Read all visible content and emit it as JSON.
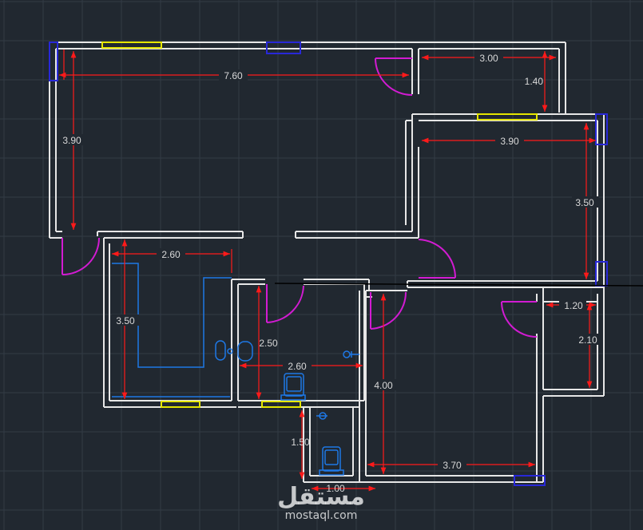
{
  "colors": {
    "background": "#212830",
    "grid": "#323b45",
    "wall": "#e6e6e6",
    "dimension": "#ff1a1a",
    "door": "#d21bd2",
    "window_yellow": "#e6e600",
    "window_blue": "#2828d8",
    "fixture": "#1e78e6",
    "cut_line": "#000000"
  },
  "dimensions": {
    "d760": "7.60",
    "d300": "3.00",
    "d140": "1.40",
    "d390a": "3.90",
    "d390b": "3.90",
    "d350a": "3.50",
    "d260a": "2.60",
    "d350b": "3.50",
    "d250": "2.50",
    "d260b": "2.60",
    "d400": "4.00",
    "d120": "1.20",
    "d210": "2.10",
    "d150": "1.50",
    "d370": "3.70",
    "d100": "1.00"
  },
  "watermark": {
    "arabic": "مستقل",
    "latin": "mostaql.com"
  }
}
